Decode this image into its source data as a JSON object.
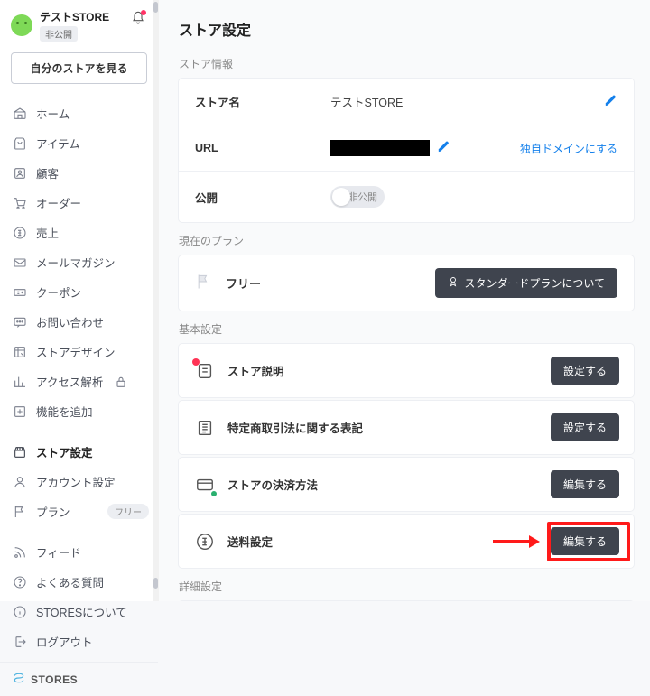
{
  "header": {
    "store_name": "テストSTORE",
    "status": "非公開",
    "view_store": "自分のストアを見る"
  },
  "nav_main": [
    {
      "id": "home",
      "label": "ホーム"
    },
    {
      "id": "items",
      "label": "アイテム"
    },
    {
      "id": "customers",
      "label": "顧客"
    },
    {
      "id": "orders",
      "label": "オーダー"
    },
    {
      "id": "sales",
      "label": "売上"
    },
    {
      "id": "mailmag",
      "label": "メールマガジン"
    },
    {
      "id": "coupons",
      "label": "クーポン"
    },
    {
      "id": "contact",
      "label": "お問い合わせ"
    },
    {
      "id": "design",
      "label": "ストアデザイン"
    },
    {
      "id": "analytics",
      "label": "アクセス解析",
      "locked": true
    },
    {
      "id": "add",
      "label": "機能を追加"
    }
  ],
  "nav_settings": [
    {
      "id": "store_settings",
      "label": "ストア設定",
      "active": true
    },
    {
      "id": "account",
      "label": "アカウント設定"
    },
    {
      "id": "plan",
      "label": "プラン",
      "tag": "フリー"
    }
  ],
  "nav_footer": [
    {
      "id": "feed",
      "label": "フィード"
    },
    {
      "id": "faq",
      "label": "よくある質問"
    },
    {
      "id": "about",
      "label": "STORESについて"
    },
    {
      "id": "logout",
      "label": "ログアウト"
    }
  ],
  "brand": "STORES",
  "page": {
    "title": "ストア設定",
    "section_info": "ストア情報",
    "info": {
      "name_label": "ストア名",
      "name_value": "テストSTORE",
      "url_label": "URL",
      "custom_domain": "独自ドメインにする",
      "public_label": "公開",
      "public_status": "非公開"
    },
    "section_plan": "現在のプラン",
    "plan": {
      "name": "フリー",
      "upgrade": "スタンダードプランについて"
    },
    "section_basic": "基本設定",
    "basic": [
      {
        "id": "desc",
        "label": "ストア説明",
        "action": "設定する",
        "notif": true
      },
      {
        "id": "law",
        "label": "特定商取引法に関する表記",
        "action": "設定する"
      },
      {
        "id": "payment",
        "label": "ストアの決済方法",
        "action": "編集する",
        "badge": "green"
      },
      {
        "id": "shipping",
        "label": "送料設定",
        "action": "編集する",
        "highlight": true
      }
    ],
    "section_detail": "詳細設定"
  }
}
